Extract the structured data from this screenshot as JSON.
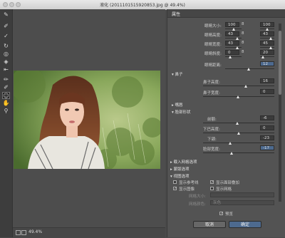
{
  "window": {
    "title": "液化 (2011101515920853.jpg @ 49.4%)"
  },
  "tools": [
    {
      "icon": "warp-brush-icon"
    },
    {
      "icon": "reconstruct-brush-icon"
    },
    {
      "icon": "smooth-brush-icon"
    },
    {
      "icon": "twirl-icon"
    },
    {
      "icon": "pucker-icon"
    },
    {
      "icon": "bloat-icon"
    },
    {
      "icon": "push-left-icon"
    },
    {
      "icon": "freeze-mask-icon"
    },
    {
      "icon": "thaw-mask-icon"
    },
    {
      "icon": "face-tool-icon"
    },
    {
      "icon": "hand-tool-icon"
    },
    {
      "icon": "zoom-tool-icon"
    }
  ],
  "status": {
    "zoom": "49.4%"
  },
  "panel": {
    "tab": "属性",
    "eye_rows": [
      {
        "label": "眼睛大小:",
        "left": "100",
        "right": "100"
      },
      {
        "label": "眼睛高度:",
        "left": "43",
        "right": "43"
      },
      {
        "label": "眼睛宽度:",
        "left": "43",
        "right": "45"
      },
      {
        "label": "眼睛斜度:",
        "left": "0",
        "right": "20"
      },
      {
        "label": "眼睛距离:",
        "value": "12"
      }
    ],
    "sections": {
      "nose": "鼻子",
      "mouth": "嘴唇",
      "face_shape": "脸部形状",
      "load_mesh": "载入网格选项",
      "mask": "蒙版选项",
      "view": "视图选项"
    },
    "nose_rows": [
      {
        "label": "鼻子高度:",
        "value": "16"
      },
      {
        "label": "鼻子宽度:",
        "value": "0"
      }
    ],
    "face_rows": [
      {
        "label": "前额:",
        "value": "-6"
      },
      {
        "label": "下巴高度:",
        "value": "0"
      },
      {
        "label": "下颌:",
        "value": "-23"
      },
      {
        "label": "脸部宽度:",
        "value": "-17"
      }
    ],
    "view_options": {
      "show_guides": "显示参考线",
      "show_face_overlay": "显示面部叠加",
      "show_image": "显示图像",
      "show_mesh": "显示网格",
      "mesh_size_label": "网格大小:",
      "mesh_color_label": "网格颜色:",
      "mesh_color_value": "灰色"
    },
    "preview_label": "预览",
    "cancel": "取消",
    "ok": "确定"
  },
  "colors": {
    "panel_bg": "#535353",
    "canvas_bg": "#4d4d4d",
    "accent": "#4d6a8f"
  }
}
